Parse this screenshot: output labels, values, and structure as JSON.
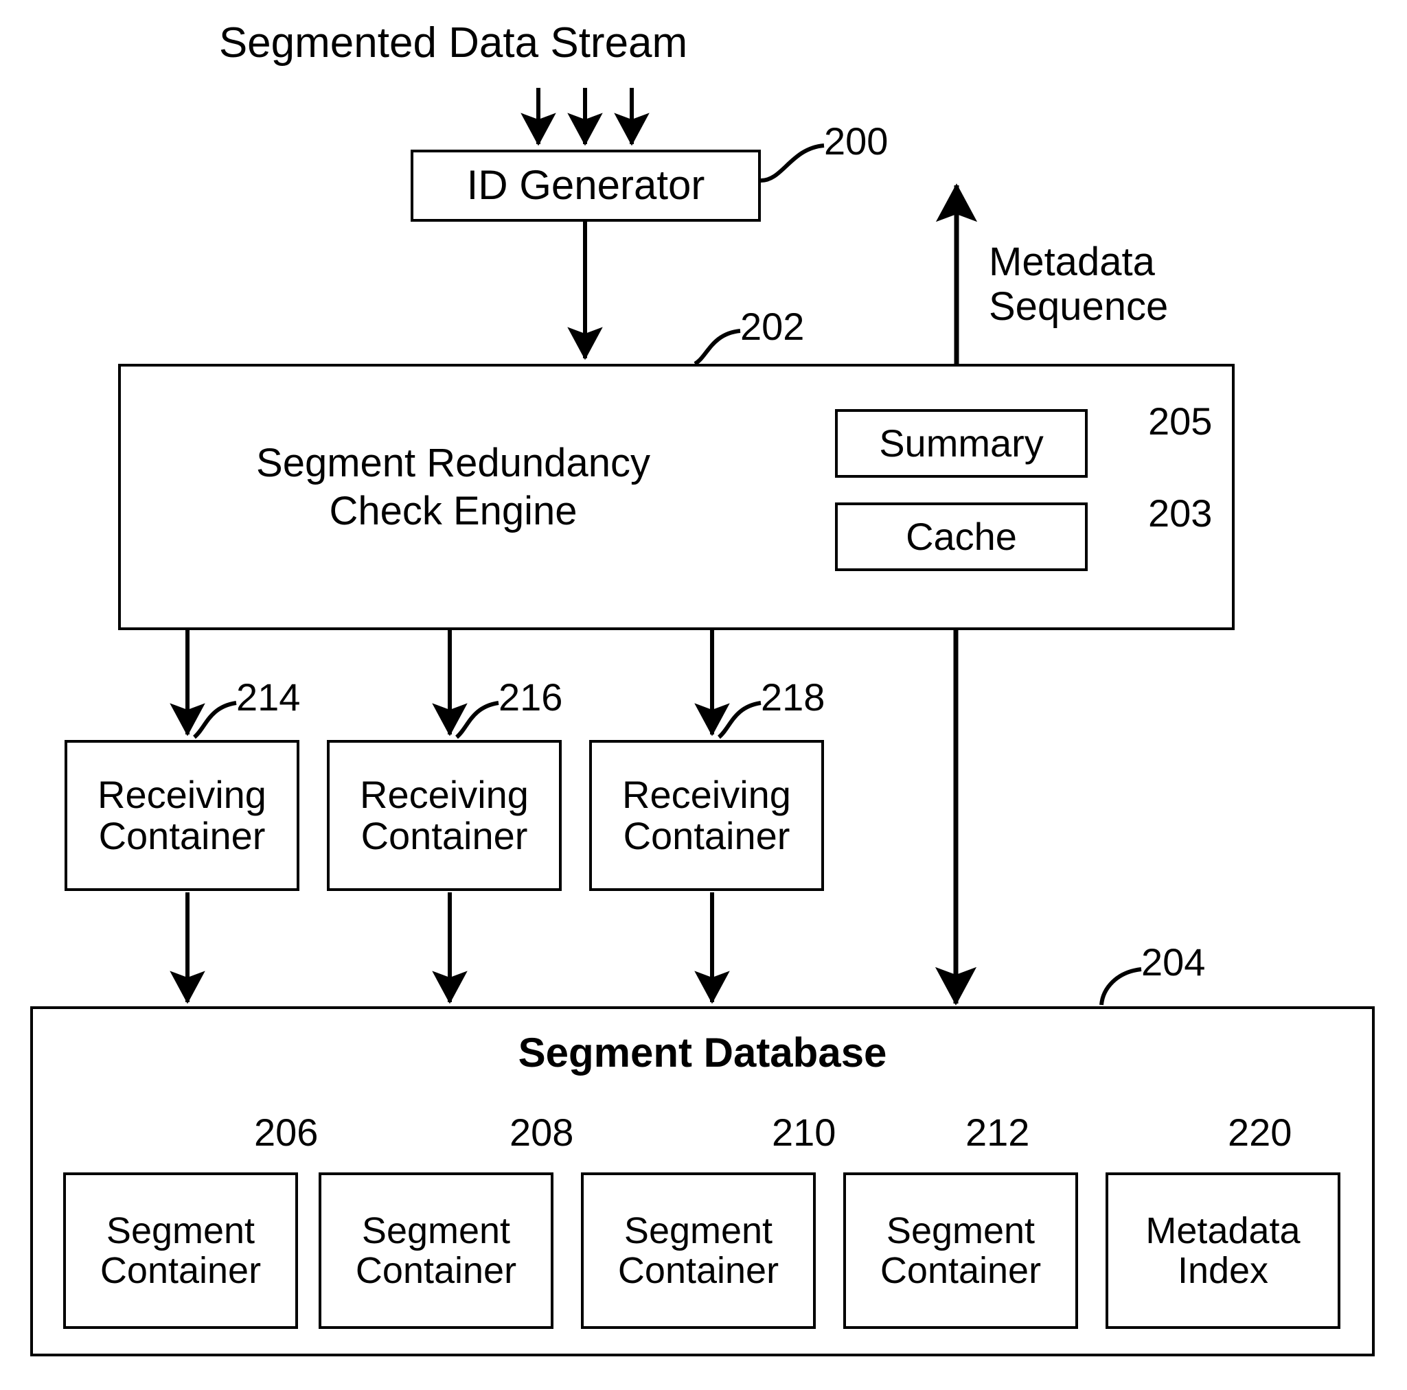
{
  "figure": {
    "title_text": "Segmented Data Stream",
    "metadata_sequence_label": "Metadata\nSequence"
  },
  "nodes": {
    "id_generator": {
      "label": "ID Generator",
      "ref": "200"
    },
    "engine": {
      "label": "Segment Redundancy\nCheck Engine",
      "ref": "202"
    },
    "summary": {
      "label": "Summary",
      "ref": "205"
    },
    "cache": {
      "label": "Cache",
      "ref": "203"
    },
    "segment_database": {
      "label": "Segment Database",
      "ref": "204"
    }
  },
  "receiving_containers": [
    {
      "label": "Receiving\nContainer",
      "ref": "214"
    },
    {
      "label": "Receiving\nContainer",
      "ref": "216"
    },
    {
      "label": "Receiving\nContainer",
      "ref": "218"
    }
  ],
  "database_items": [
    {
      "label": "Segment\nContainer",
      "ref": "206"
    },
    {
      "label": "Segment\nContainer",
      "ref": "208"
    },
    {
      "label": "Segment\nContainer",
      "ref": "210"
    },
    {
      "label": "Segment\nContainer",
      "ref": "212"
    },
    {
      "label": "Metadata\nIndex",
      "ref": "220"
    }
  ],
  "colors": {
    "stroke": "#000000",
    "background": "#ffffff"
  }
}
